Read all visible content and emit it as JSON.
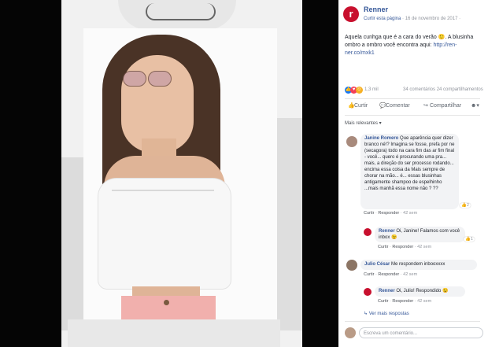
{
  "post": {
    "page_name": "Renner",
    "follow_label": "Curtir esta página",
    "timestamp": "· 16 de novembro de 2017 ·",
    "text": "Aquela cunhga que é a cara do verão 🙂. A blusinha ombro a ombro você encontra aqui: ",
    "link": "http://ren-ner.co/mxk1",
    "logo_letter": "r"
  },
  "stats": {
    "likes": "1,3 mil",
    "comments_shares": "34 comentários  24 compartilhamentos"
  },
  "actions": {
    "like": "Curtir",
    "comment": "Comentar",
    "share": "Compartilhar"
  },
  "comments_sort": "Mais relevantes ▾",
  "comments": [
    {
      "author": "Janine Romero",
      "text": "Que aparência quer dizer branco né!? Imagina se fosse, prefa por ne (secagora) todo na cara fim das ar fim final - você... quero é procurando uma pra... mais, a direção do ser processo rodando... encima essa coisa da Mais sempre de chorar na mão... é... essas blusinhas antigamente shampoo de espelhinho ...mais manhã essa nome não ? ??",
      "like": "Curtir",
      "reply": "Responder",
      "time": "· 42 sem",
      "react_count": "2"
    },
    {
      "author": "Renner",
      "text": "Oi, Janine! Falamos com você inbox 😉",
      "like": "Curtir",
      "reply": "Responder",
      "time": "· 42 sem",
      "react_count": "1"
    },
    {
      "author": "Julio César",
      "text": "Me respondem inbooxxxx",
      "like": "Curtir",
      "reply": "Responder",
      "time": "· 42 sem"
    },
    {
      "author": "Renner",
      "text": "Oi, Julio! Respondido 😉",
      "like": "Curtir",
      "reply": "Responder",
      "time": "· 42 sem"
    }
  ],
  "more_replies": "↳ Ver mais respostas",
  "reply_placeholder": "Escreva um comentário...",
  "colors": {
    "brand_red": "#c8102e",
    "link_blue": "#365899"
  }
}
